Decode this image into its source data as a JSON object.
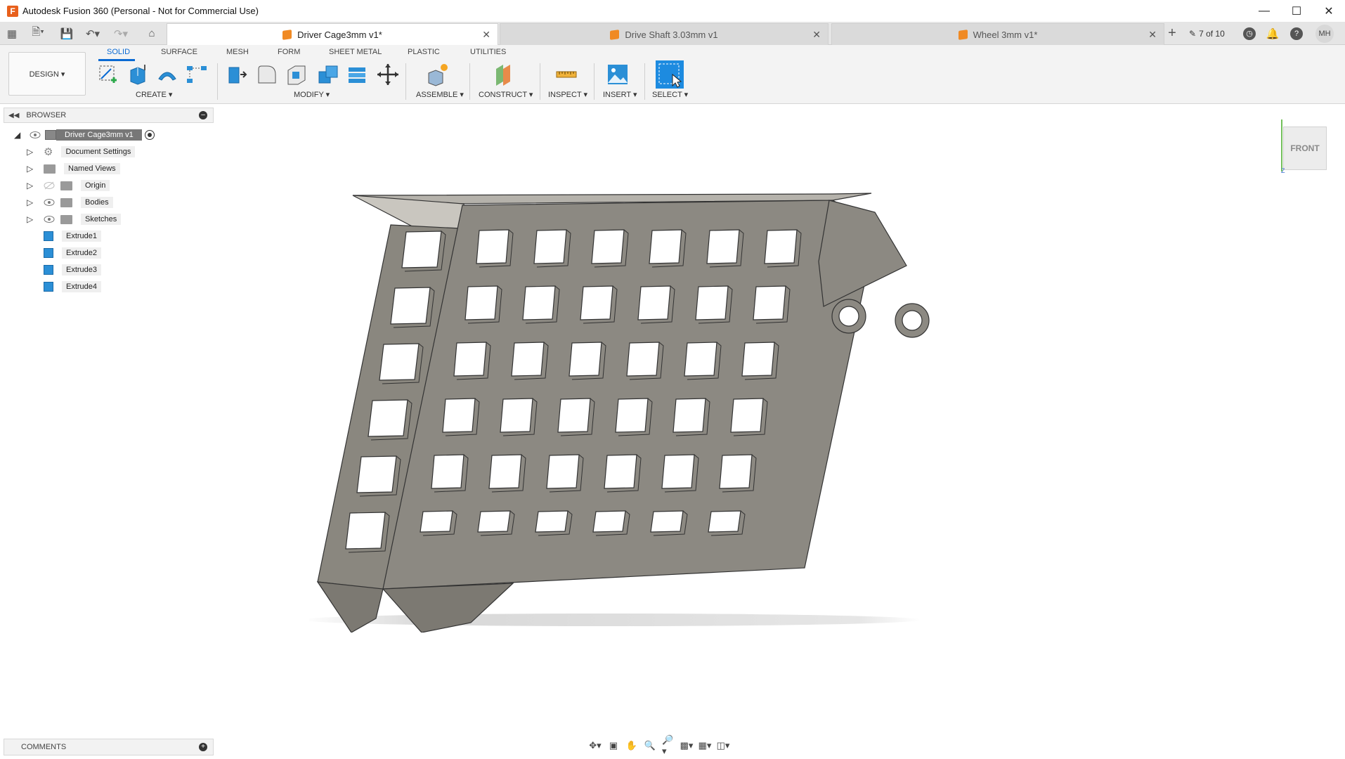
{
  "window": {
    "title": "Autodesk Fusion 360 (Personal - Not for Commercial Use)"
  },
  "tabs": [
    {
      "label": "Driver Cage3mm v1*",
      "active": true
    },
    {
      "label": "Drive Shaft 3.03mm v1",
      "active": false
    },
    {
      "label": "Wheel 3mm v1*",
      "active": false
    }
  ],
  "job_status": "7 of 10",
  "user_initials": "MH",
  "toolbar": {
    "workspace": "DESIGN ▾",
    "workspace_tabs": [
      "SOLID",
      "SURFACE",
      "MESH",
      "FORM",
      "SHEET METAL",
      "PLASTIC",
      "UTILITIES"
    ],
    "groups": [
      "CREATE ▾",
      "MODIFY ▾",
      "ASSEMBLE ▾",
      "CONSTRUCT ▾",
      "INSPECT ▾",
      "INSERT ▾",
      "SELECT ▾"
    ]
  },
  "browser": {
    "title": "BROWSER",
    "root": "Driver Cage3mm v1",
    "items": [
      "Document Settings",
      "Named Views",
      "Origin",
      "Bodies",
      "Sketches"
    ],
    "features": [
      "Extrude1",
      "Extrude2",
      "Extrude3",
      "Extrude4"
    ]
  },
  "comments": {
    "title": "COMMENTS"
  },
  "viewcube": {
    "face": "FRONT"
  },
  "colors": {
    "accent": "#0a6ad3",
    "model": "#8c8982",
    "feature_icon": "#2b8fd6"
  }
}
